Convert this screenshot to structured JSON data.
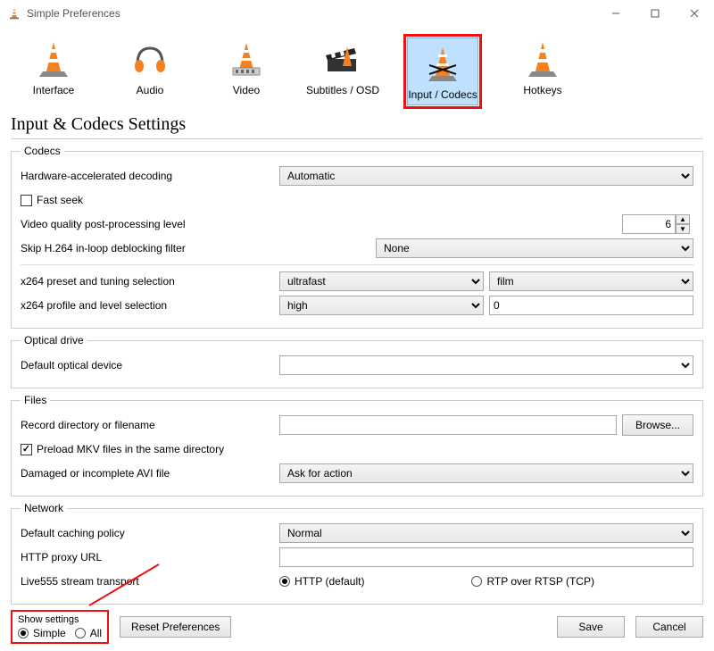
{
  "window": {
    "title": "Simple Preferences"
  },
  "tabs": {
    "interface": "Interface",
    "audio": "Audio",
    "video": "Video",
    "subtitles": "Subtitles / OSD",
    "input": "Input / Codecs",
    "hotkeys": "Hotkeys"
  },
  "page_title": "Input & Codecs Settings",
  "codecs": {
    "legend": "Codecs",
    "hw_decoding_label": "Hardware-accelerated decoding",
    "hw_decoding_value": "Automatic",
    "fast_seek": "Fast seek",
    "vq_label": "Video quality post-processing level",
    "vq_value": "6",
    "skip_label": "Skip H.264 in-loop deblocking filter",
    "skip_value": "None",
    "x264_preset_label": "x264 preset and tuning selection",
    "x264_preset_value": "ultrafast",
    "x264_tune_value": "film",
    "x264_profile_label": "x264 profile and level selection",
    "x264_profile_value": "high",
    "x264_level_value": "0"
  },
  "optical": {
    "legend": "Optical drive",
    "default_label": "Default optical device",
    "default_value": ""
  },
  "files": {
    "legend": "Files",
    "record_label": "Record directory or filename",
    "record_value": "",
    "browse": "Browse...",
    "preload_label": "Preload MKV files in the same directory",
    "avi_label": "Damaged or incomplete AVI file",
    "avi_value": "Ask for action"
  },
  "network": {
    "legend": "Network",
    "caching_label": "Default caching policy",
    "caching_value": "Normal",
    "proxy_label": "HTTP proxy URL",
    "proxy_value": "",
    "live555_label": "Live555 stream transport",
    "http_default": "HTTP (default)",
    "rtp_rtsp": "RTP over RTSP (TCP)"
  },
  "bottom": {
    "show_settings": "Show settings",
    "simple": "Simple",
    "all": "All",
    "reset": "Reset Preferences",
    "save": "Save",
    "cancel": "Cancel"
  }
}
